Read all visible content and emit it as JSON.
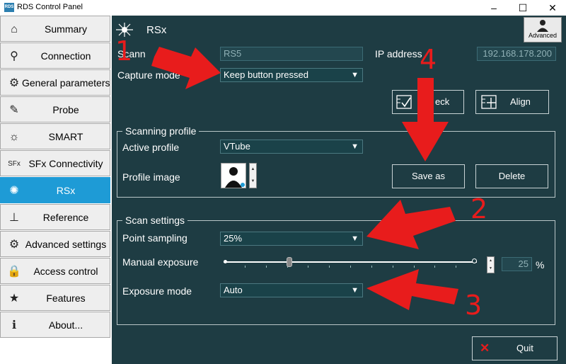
{
  "window": {
    "title": "RDS Control Panel",
    "app_icon_text": "RDS"
  },
  "sidebar": {
    "items": [
      {
        "label": "Summary",
        "icon": "home-icon",
        "glyph": "⌂"
      },
      {
        "label": "Connection",
        "icon": "plug-icon",
        "glyph": "⚲"
      },
      {
        "label": "General parameters",
        "icon": "gear-icon",
        "glyph": "⚙"
      },
      {
        "label": "Probe",
        "icon": "probe-icon",
        "glyph": "✎"
      },
      {
        "label": "SMART",
        "icon": "smart-icon",
        "glyph": "☼"
      },
      {
        "label": "SFx Connectivity",
        "icon": "sfx-icon",
        "glyph": "SFx"
      },
      {
        "label": "RSx",
        "icon": "rsx-icon",
        "glyph": "✺"
      },
      {
        "label": "Reference",
        "icon": "reference-axes-icon",
        "glyph": "⊥"
      },
      {
        "label": "Advanced settings",
        "icon": "advanced-gear-icon",
        "glyph": "⚙"
      },
      {
        "label": "Access control",
        "icon": "lock-icon",
        "glyph": "🔒"
      },
      {
        "label": "Features",
        "icon": "star-icon",
        "glyph": "★"
      },
      {
        "label": "About...",
        "icon": "info-icon",
        "glyph": "ℹ"
      }
    ],
    "active": "RSx"
  },
  "header": {
    "title": "RSx",
    "advanced_label": "Advanced"
  },
  "device": {
    "scanner_label": "Scann",
    "scanner_value": "RS5",
    "ip_label": "IP address",
    "ip_value": "192.168.178.200",
    "capture_label": "Capture mode",
    "capture_value": "Keep button pressed",
    "check_label": "eck",
    "align_label": "Align"
  },
  "scanning_profile": {
    "title": "Scanning profile",
    "active_label": "Active profile",
    "active_value": "VTube",
    "image_label": "Profile image",
    "save_as": "Save as",
    "delete": "Delete"
  },
  "scan_settings": {
    "title": "Scan settings",
    "point_label": "Point sampling",
    "point_value": "25%",
    "exposure_label": "Manual exposure",
    "exposure_value": "25",
    "exposure_unit": "%",
    "exposure_level": 0.26,
    "mode_label": "Exposure mode",
    "mode_value": "Auto"
  },
  "footer": {
    "quit_label": "Quit"
  },
  "annotations": [
    "1",
    "4",
    "2",
    "3"
  ],
  "colors": {
    "background": "#1e3c43",
    "active_nav": "#1e9bd6",
    "arrow": "#e81c1c"
  }
}
